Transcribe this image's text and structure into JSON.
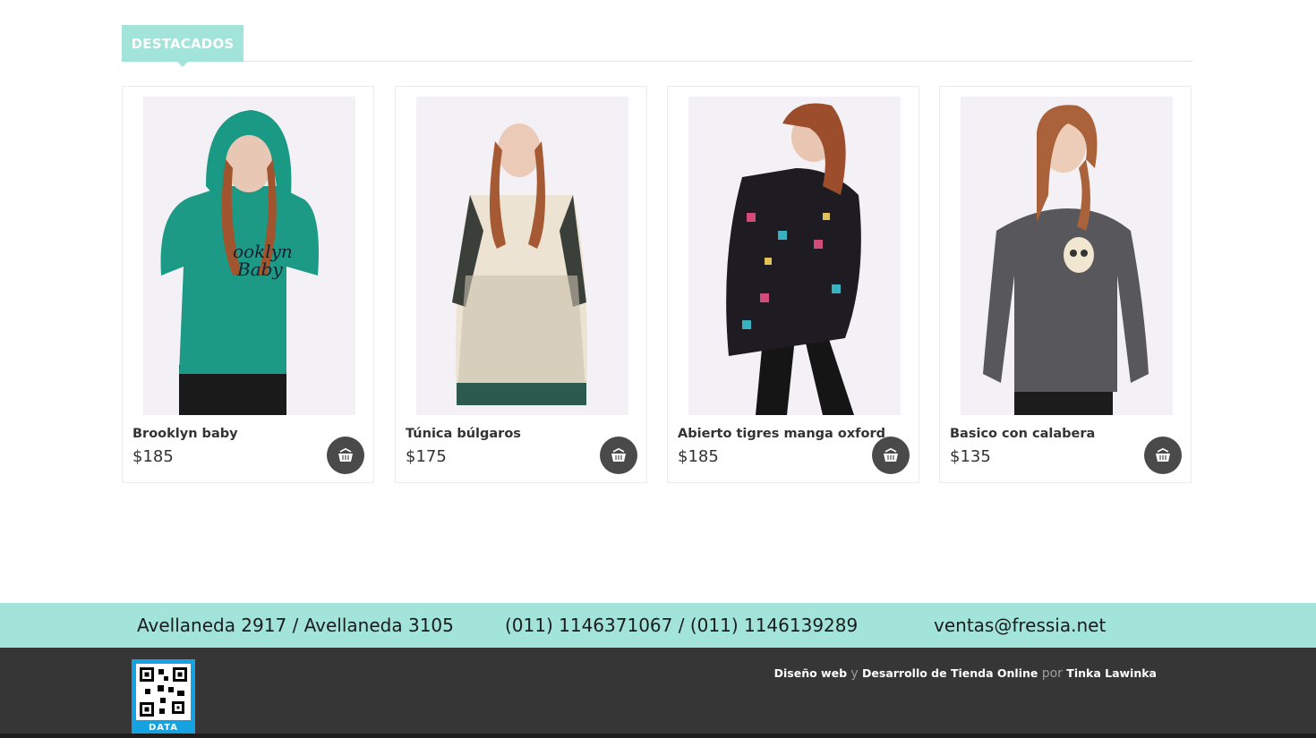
{
  "section": {
    "title": "DESTACADOS"
  },
  "products": [
    {
      "name": "Brooklyn baby",
      "price": "$185"
    },
    {
      "name": "Túnica búlgaros",
      "price": "$175"
    },
    {
      "name": "Abierto tigres manga oxford",
      "price": "$185"
    },
    {
      "name": "Basico con calabera",
      "price": "$135"
    }
  ],
  "footer": {
    "address": "Avellaneda 2917 / Avellaneda 3105",
    "phones": "(011) 1146371067 / (011) 1146139289",
    "email": "ventas@fressia.net",
    "credits": {
      "link1": "Diseño web",
      "sep1": "y",
      "link2": "Desarrollo de Tienda Online",
      "sep2": "por",
      "link3": "Tinka Lawinka"
    },
    "qr_label": "DATA"
  },
  "colors": {
    "accent": "#a2e3da",
    "footer_dark": "#363636",
    "cart_button": "#4a4a4a",
    "qr_blue": "#16a2e0"
  },
  "icons": {
    "cart": "basket-icon"
  }
}
